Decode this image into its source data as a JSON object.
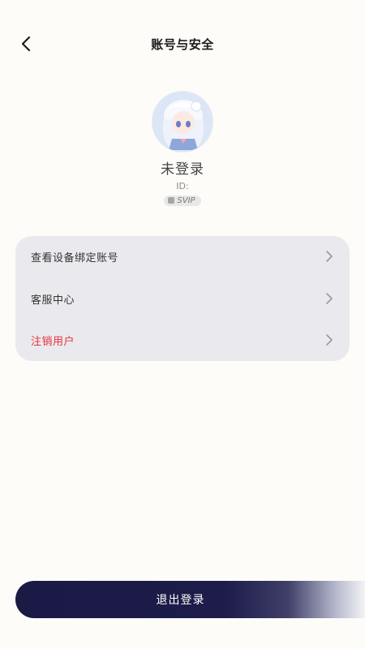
{
  "header": {
    "title": "账号与安全",
    "back_icon": "chevron-left-icon"
  },
  "profile": {
    "username": "未登录",
    "id_label": "ID:",
    "vip_label": "SVIP"
  },
  "menu": {
    "items": [
      {
        "label": "查看设备绑定账号",
        "danger": false
      },
      {
        "label": "客服中心",
        "danger": false
      },
      {
        "label": "注销用户",
        "danger": true
      }
    ]
  },
  "logout": {
    "label": "退出登录"
  },
  "colors": {
    "background": "#fdfcf9",
    "card": "#eaeaee",
    "danger": "#e5303a",
    "button": "#1b1a45"
  }
}
